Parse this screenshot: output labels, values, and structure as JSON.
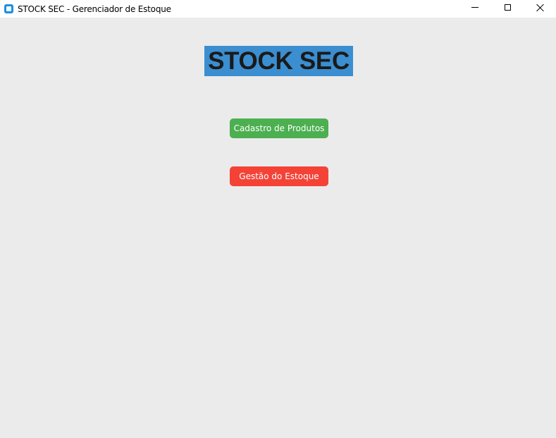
{
  "window": {
    "title": "STOCK SEC - Gerenciador de Estoque",
    "icon": "app-window-icon",
    "controls": [
      "minimize",
      "maximize",
      "close"
    ]
  },
  "main": {
    "heading": "STOCK SEC",
    "buttons": {
      "cadastro_label": "Cadastro de Produtos",
      "gestao_label": "Gestão do Estoque"
    }
  },
  "colors": {
    "background": "#ebebeb",
    "heading_bg": "#3b8ed0",
    "cadastro_button": "#4caf50",
    "gestao_button": "#f44336"
  }
}
